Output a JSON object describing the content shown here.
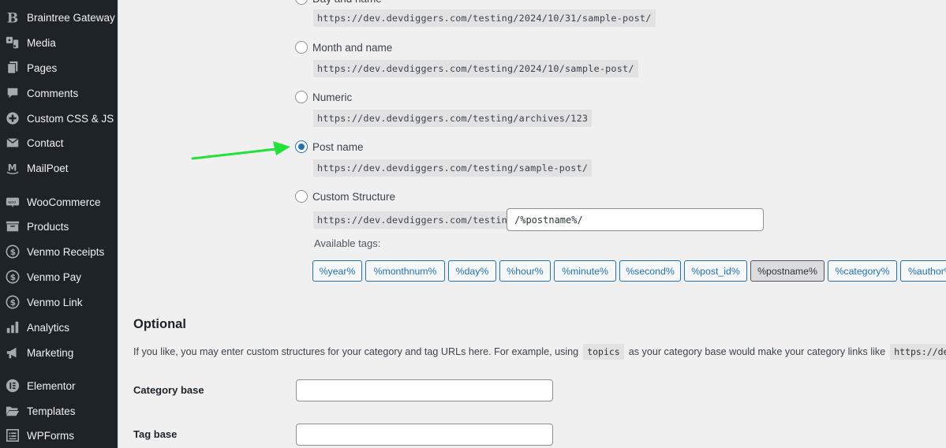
{
  "sidebar": {
    "items": [
      {
        "label": "Braintree Gateway",
        "icon": "braintree-icon"
      },
      {
        "label": "Media",
        "icon": "media-icon"
      },
      {
        "label": "Pages",
        "icon": "pages-icon"
      },
      {
        "label": "Comments",
        "icon": "comments-icon"
      },
      {
        "label": "Custom CSS & JS",
        "icon": "plus-circle-icon"
      },
      {
        "label": "Contact",
        "icon": "envelope-icon"
      },
      {
        "label": "MailPoet",
        "icon": "mailpoet-icon"
      },
      {
        "label": "WooCommerce",
        "icon": "woocommerce-icon"
      },
      {
        "label": "Products",
        "icon": "archive-box-icon"
      },
      {
        "label": "Venmo Receipts",
        "icon": "dollar-circle-icon"
      },
      {
        "label": "Venmo Pay",
        "icon": "dollar-circle-icon"
      },
      {
        "label": "Venmo Link",
        "icon": "dollar-circle-icon"
      },
      {
        "label": "Analytics",
        "icon": "bar-chart-icon"
      },
      {
        "label": "Marketing",
        "icon": "megaphone-icon"
      },
      {
        "label": "Elementor",
        "icon": "elementor-icon"
      },
      {
        "label": "Templates",
        "icon": "folder-open-icon"
      },
      {
        "label": "WPForms",
        "icon": "wpforms-icon"
      }
    ]
  },
  "permalinks": {
    "options": [
      {
        "label": "Day and name",
        "example": "https://dev.devdiggers.com/testing/2024/10/31/sample-post/",
        "checked": false
      },
      {
        "label": "Month and name",
        "example": "https://dev.devdiggers.com/testing/2024/10/sample-post/",
        "checked": false
      },
      {
        "label": "Numeric",
        "example": "https://dev.devdiggers.com/testing/archives/123",
        "checked": false
      },
      {
        "label": "Post name",
        "example": "https://dev.devdiggers.com/testing/sample-post/",
        "checked": true
      },
      {
        "label": "Custom Structure",
        "example": "https://dev.devdiggers.com/testing",
        "checked": false
      }
    ],
    "custom_structure_value": "/%postname%/",
    "available_tags_label": "Available tags:",
    "tags": [
      {
        "label": "%year%",
        "active": false
      },
      {
        "label": "%monthnum%",
        "active": false
      },
      {
        "label": "%day%",
        "active": false
      },
      {
        "label": "%hour%",
        "active": false
      },
      {
        "label": "%minute%",
        "active": false
      },
      {
        "label": "%second%",
        "active": false
      },
      {
        "label": "%post_id%",
        "active": false
      },
      {
        "label": "%postname%",
        "active": true
      },
      {
        "label": "%category%",
        "active": false
      },
      {
        "label": "%author%",
        "active": false
      }
    ]
  },
  "optional": {
    "title": "Optional",
    "help_before": "If you like, you may enter custom structures for your category and tag URLs here. For example, using",
    "help_code": "topics",
    "help_after": "as your category base would make your category links like",
    "help_url": "https://dev.devdiggers.com/testing/topics/uncategorized/",
    "category_base_label": "Category base",
    "category_base_value": "",
    "tag_base_label": "Tag base",
    "tag_base_value": ""
  },
  "annotation": {
    "arrow_color": "#22e23a",
    "points_to": "Post name"
  },
  "colors": {
    "sidebar_bg": "#1d2327",
    "accent": "#2271b1",
    "page_bg": "#f0f0f1"
  }
}
